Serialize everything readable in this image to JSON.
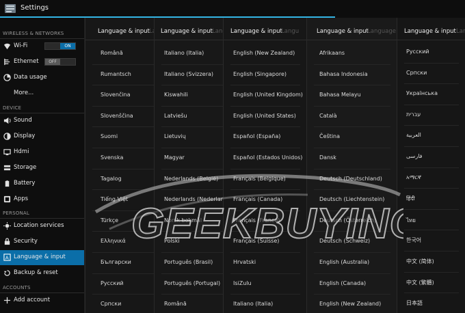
{
  "titlebar": {
    "title": "Settings"
  },
  "sidebar": {
    "sections": [
      {
        "header": "WIRELESS & NETWORKS"
      },
      {
        "header": "DEVICE"
      },
      {
        "header": "PERSONAL"
      },
      {
        "header": "ACCOUNTS"
      }
    ],
    "items": [
      {
        "label": "Wi-Fi",
        "icon": "wifi-icon",
        "toggle": "ON"
      },
      {
        "label": "Ethernet",
        "icon": "ethernet-icon",
        "toggle": "OFF"
      },
      {
        "label": "Data usage",
        "icon": "data-usage-icon"
      },
      {
        "label": "More...",
        "icon": ""
      },
      {
        "label": "Sound",
        "icon": "sound-icon"
      },
      {
        "label": "Display",
        "icon": "display-icon"
      },
      {
        "label": "Hdmi",
        "icon": "hdmi-icon"
      },
      {
        "label": "Storage",
        "icon": "storage-icon"
      },
      {
        "label": "Battery",
        "icon": "battery-icon"
      },
      {
        "label": "Apps",
        "icon": "apps-icon"
      },
      {
        "label": "Location services",
        "icon": "location-icon"
      },
      {
        "label": "Security",
        "icon": "lock-icon"
      },
      {
        "label": "Language & input",
        "icon": "language-icon",
        "selected": true
      },
      {
        "label": "Backup & reset",
        "icon": "backup-icon"
      },
      {
        "label": "Add account",
        "icon": "add-icon"
      }
    ]
  },
  "panels": [
    {
      "title": "Language & input",
      "ghost": "Langu",
      "rows": [
        "Română",
        "Rumantsch",
        "Slovenčina",
        "Slovenščina",
        "Suomi",
        "Svenska",
        "Tagalog",
        "Tiếng Việt",
        "Türkçe",
        "Ελληνικά",
        "Български",
        "Русский",
        "Српски"
      ]
    },
    {
      "title": "Language & input",
      "ghost": "Langu",
      "rows": [
        "Italiano (Italia)",
        "Italiano (Svizzera)",
        "Kiswahili",
        "Latviešu",
        "Lietuvių",
        "Magyar",
        "Nederlands (België)",
        "Nederlands (Nederland)",
        "Norsk bokmål",
        "Polski",
        "Português (Brasil)",
        "Português (Portugal)",
        "Română"
      ]
    },
    {
      "title": "Language & input",
      "ghost": "Langu",
      "rows": [
        "English (New Zealand)",
        "English (Singapore)",
        "English (United Kingdom)",
        "English (United States)",
        "Español (España)",
        "Español (Estados Unidos)",
        "Français (Belgique)",
        "Français (Canada)",
        "Français (France)",
        "Français (Suisse)",
        "Hrvatski",
        "IsiZulu",
        "Italiano (Italia)"
      ]
    },
    {
      "title": "Language & input",
      "ghost": "Language",
      "rows": [
        "Afrikaans",
        "Bahasa Indonesia",
        "Bahasa Melayu",
        "Català",
        "Čeština",
        "Dansk",
        "Deutsch (Deutschland)",
        "Deutsch (Liechtenstein)",
        "Deutsch (Österreich)",
        "Deutsch (Schweiz)",
        "English (Australia)",
        "English (Canada)",
        "English (New Zealand)"
      ]
    },
    {
      "title": "Language & input",
      "ghost": "Langu",
      "rows": [
        "Русский",
        "Српски",
        "Українська",
        "עברית",
        "العربية",
        "فارسی",
        "አማርኛ",
        "हिंदी",
        "ไทย",
        "한국어",
        "中文 (简体)",
        "中文 (繁體)",
        "日本語"
      ]
    }
  ],
  "watermark": {
    "text": "GEEKBUYING"
  }
}
